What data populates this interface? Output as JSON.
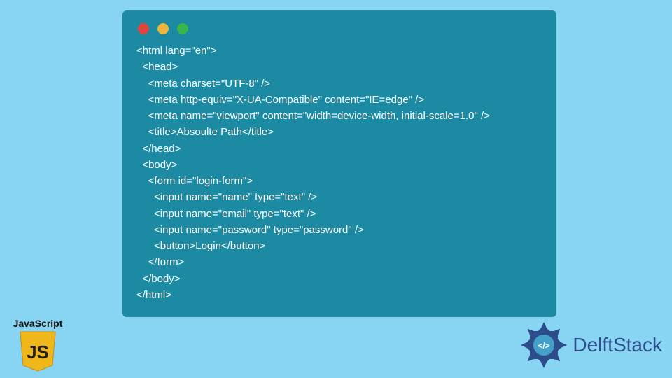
{
  "code_lines": [
    "<html lang=\"en\">",
    "  <head>",
    "    <meta charset=\"UTF-8\" />",
    "    <meta http-equiv=\"X-UA-Compatible\" content=\"IE=edge\" />",
    "    <meta name=\"viewport\" content=\"width=device-width, initial-scale=1.0\" />",
    "    <title>Absoulte Path</title>",
    "  </head>",
    "  <body>",
    "    <form id=\"login-form\">",
    "      <input name=\"name\" type=\"text\" />",
    "      <input name=\"email\" type=\"text\" />",
    "      <input name=\"password\" type=\"password\" />",
    "      <button>Login</button>",
    "    </form>",
    "  </body>",
    "</html>"
  ],
  "js_badge": {
    "label": "JavaScript",
    "logo_text": "JS"
  },
  "brand": {
    "name": "DelftStack"
  },
  "colors": {
    "page_bg": "#87d5f2",
    "window_bg": "#1d8aa3",
    "dot_red": "#e0443e",
    "dot_yellow": "#efb53b",
    "dot_green": "#39b54a",
    "js_yellow": "#f0b71a",
    "brand_blue": "#2d4d8a"
  }
}
